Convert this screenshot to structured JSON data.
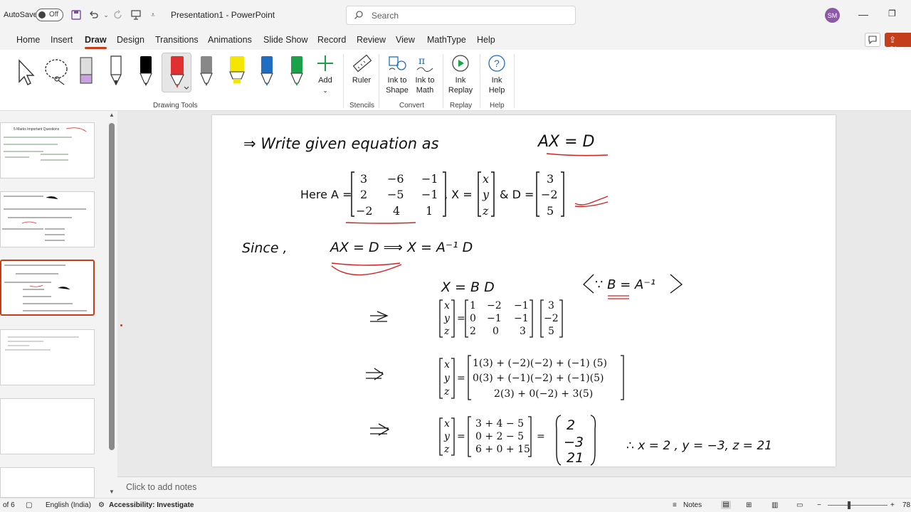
{
  "titlebar": {
    "autosave_label": "AutoSave",
    "autosave_state": "Off",
    "doc_title": "Presentation1  -  PowerPoint",
    "search_placeholder": "Search",
    "avatar_initials": "SM"
  },
  "tabs": [
    "Home",
    "Insert",
    "Draw",
    "Design",
    "Transitions",
    "Animations",
    "Slide Show",
    "Record",
    "Review",
    "View",
    "MathType",
    "Help"
  ],
  "active_tab": "Draw",
  "share_label": "Sha",
  "ribbon": {
    "add_label": "Add",
    "ruler_label": "Ruler",
    "ink_to_shape_label": "Ink to Shape",
    "ink_to_math_label": "Ink to Math",
    "ink_replay_label": "Ink Replay",
    "ink_help_label": "Ink Help",
    "groups": {
      "drawing_tools": "Drawing Tools",
      "stencils": "Stencils",
      "convert": "Convert",
      "replay": "Replay",
      "help": "Help"
    },
    "pen_colors": [
      "#000000",
      "#e03030",
      "#888888",
      "#f5e600",
      "#1e6fc1",
      "#1aa24a"
    ]
  },
  "thumbnails": {
    "slide1_title": "5 Marks Important Questions"
  },
  "slide": {
    "line1": "⇒  Write  given  equation  as",
    "line1_eq": "AX = D",
    "here_a": "Here A =",
    "matrix_a": [
      [
        "3",
        "−6",
        "−1"
      ],
      [
        "2",
        "−5",
        "−1"
      ],
      [
        "−2",
        "4",
        "1"
      ]
    ],
    "x_eq": ", X =",
    "matrix_x": [
      "x",
      "y",
      "z"
    ],
    "and_d": "& D =",
    "matrix_d": [
      "3",
      "−2",
      "5"
    ],
    "since": "Since ,",
    "since_eq": "AX = D  ⟹  X = A⁻¹ D",
    "x_bd": "X = B D",
    "b_note": "∵ B = A⁻¹",
    "matrix_b": [
      [
        "1",
        "−2",
        "−1"
      ],
      [
        "0",
        "−1",
        "−1"
      ],
      [
        "2",
        "0",
        "3"
      ]
    ],
    "expand_rows": [
      "1(3) + (−2)(−2) + (−1) (5)",
      "0(3) + (−1)(−2) + (−1)(5)",
      "2(3) + 0(−2) + 3(5)"
    ],
    "sum_rows": [
      "3 + 4 − 5",
      "0 + 2 − 5",
      "6 + 0 + 15"
    ],
    "result": [
      "2",
      "−3",
      "21"
    ],
    "final": "∴  x = 2 , y = −3,  z = 21"
  },
  "notes_placeholder": "Click to add notes",
  "status": {
    "slide_count": "of 6",
    "language": "English (India)",
    "accessibility": "Accessibility: Investigate",
    "notes_label": "Notes",
    "zoom": "78"
  }
}
